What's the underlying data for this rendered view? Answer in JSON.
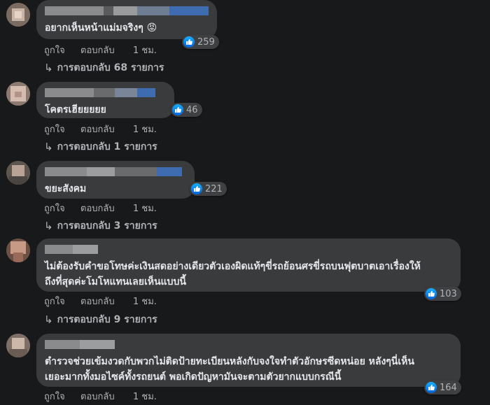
{
  "comments": [
    {
      "text": "อยากเห็นหน้าแม่มจริงๆ",
      "emoji": "😡",
      "count": "259",
      "like": "ถูกใจ",
      "reply": "ตอบกลับ",
      "time": "1 ชม.",
      "replies": "การตอบกลับ 68 รายการ"
    },
    {
      "text": "โคตรเฮียยยยย",
      "count": "46",
      "like": "ถูกใจ",
      "reply": "ตอบกลับ",
      "time": "1 ชม.",
      "replies": "การตอบกลับ 1 รายการ"
    },
    {
      "text": "ขยะสังคม",
      "count": "221",
      "like": "ถูกใจ",
      "reply": "ตอบกลับ",
      "time": "1 ชม.",
      "replies": "การตอบกลับ 3 รายการ"
    },
    {
      "text_line1": "ไม่ต้องรับคำขอโทษค่ะเงินสดอย่างเดียวตัวเองผิดแท้ๆขี่รถย้อนศรขี่รถบนฟุตบาตเอาเรื่องให้",
      "text_line2": "ถึงที่สุดค่ะโมโหแทนเลยเห็นแบบนี้",
      "count": "103",
      "like": "ถูกใจ",
      "reply": "ตอบกลับ",
      "time": "1 ชม.",
      "replies": "การตอบกลับ 9 รายการ"
    },
    {
      "text_line1": "ตำรวจช่วยเข้มงวดกับพวกไม่ติดป้ายทะเบียนหลังกับจงใจทำตัวอักษรซีดหน่อย หลังๆนี่เห็น",
      "text_line2": "เยอะมากทั้งมอไซค์ทั้งรถยนต์ พอเกิดปัญหามันจะตามตัวยากแบบกรณีนี้",
      "count": "164",
      "like": "ถูกใจ",
      "reply": "ตอบกลับ",
      "time": "1 ชม."
    }
  ],
  "colors": {
    "background": "#18191a",
    "bubble": "#3a3b3c",
    "like_blue": "#1877f2",
    "secondary_text": "#b0b3b8"
  }
}
